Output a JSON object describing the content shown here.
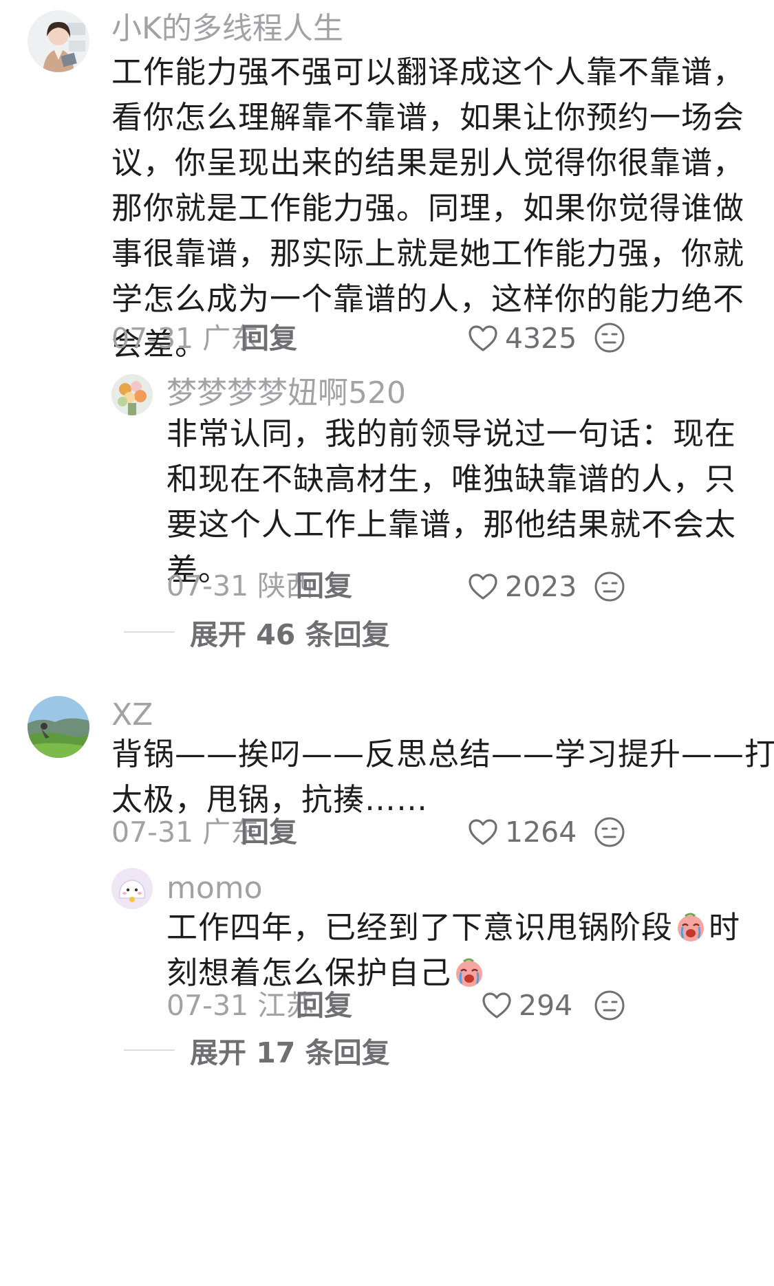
{
  "comments": [
    {
      "user": "小K的多线程人生",
      "lines": [
        "工作能力强不强可以翻译成这个人靠不靠谱，",
        "看你怎么理解靠不靠谱，如果让你预约一场会",
        "议，你呈现出来的结果是别人觉得你很靠谱，",
        "那你就是工作能力强。同理，如果你觉得谁做",
        "事很靠谱，那实际上就是她工作能力强，你就",
        "学怎么成为一个靠谱的人，这样你的能力绝不",
        "会差。"
      ],
      "date": "07-31 广东",
      "reply": "回复",
      "likes": "4325",
      "sub": {
        "user": "梦梦梦梦妞啊520",
        "lines": [
          "非常认同，我的前领导说过一句话：现在",
          "和现在不缺高材生，唯独缺靠谱的人，只",
          "要这个人工作上靠谱，那他结果就不会太",
          "差。"
        ],
        "date": "07-31 陕西",
        "reply": "回复",
        "likes": "2023"
      },
      "expand": "展开 46 条回复"
    },
    {
      "user": "XZ",
      "lines": [
        "背锅——挨叼——反思总结——学习提升——打",
        "太极，甩锅，抗揍……"
      ],
      "date": "07-31 广东",
      "reply": "回复",
      "likes": "1264",
      "sub": {
        "user": "momo",
        "line1_a": "工作四年，已经到了下意识甩锅阶段",
        "line1_b": "时",
        "line2": "刻想着怎么保护自己",
        "date": "07-31 江苏",
        "reply": "回复",
        "likes": "294"
      },
      "expand": "展开 17 条回复"
    }
  ],
  "icons": {
    "like": "heart-outline-icon",
    "dislike": "unamused-face-icon",
    "emoji": "crying-face-emoji"
  },
  "colors": {
    "username": "#a1a1a6",
    "content": "#1d1d1f",
    "meta": "#a1a1a6",
    "action": "#6f6f73"
  }
}
